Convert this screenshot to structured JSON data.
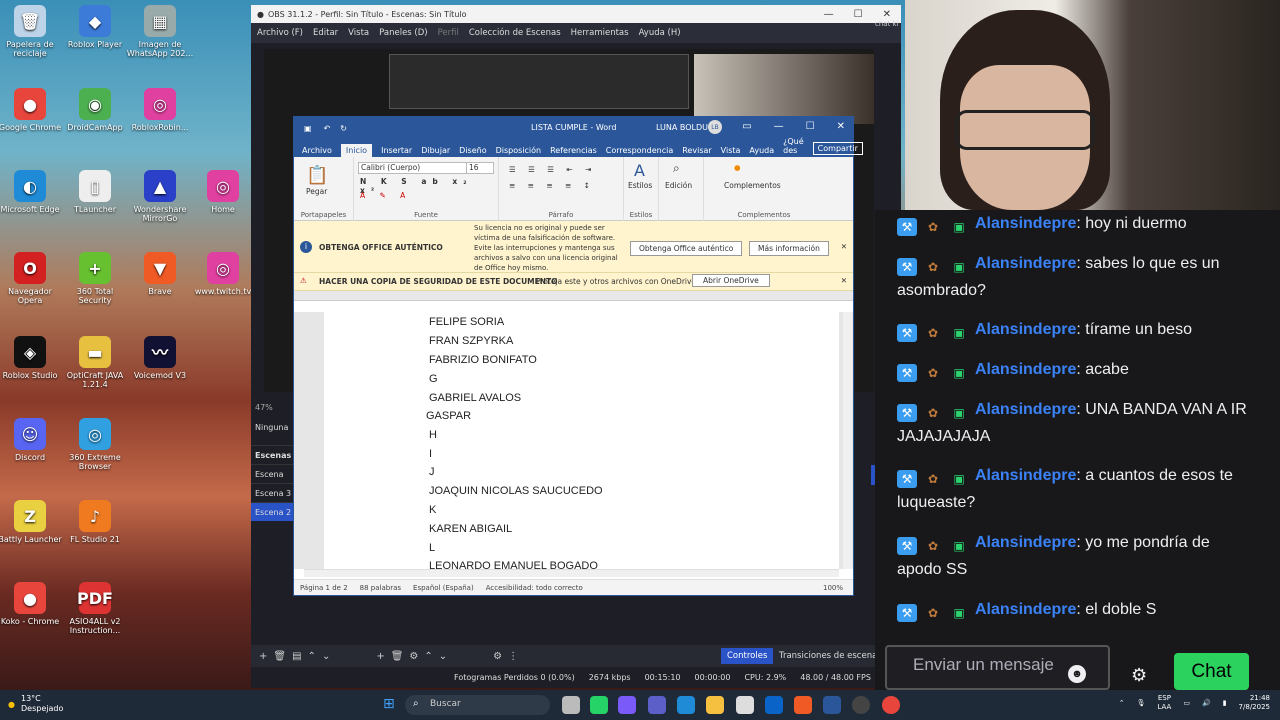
{
  "desktop": {
    "icons": [
      {
        "label": "Papelera de reciclaje",
        "glyph": "🗑",
        "color": "#bcd3e8"
      },
      {
        "label": "Roblox Player",
        "glyph": "◆",
        "color": "#3d7bd9"
      },
      {
        "label": "Imagen de WhatsApp 202...",
        "glyph": "▦",
        "color": "#9aa"
      },
      {
        "label": "Google Chrome",
        "glyph": "●",
        "color": "#e8453c"
      },
      {
        "label": "DroidCamApp",
        "glyph": "◉",
        "color": "#4caf50"
      },
      {
        "label": "RobloxRobin...",
        "glyph": "◎",
        "color": "#e040a0"
      },
      {
        "label": "Microsoft Edge",
        "glyph": "◐",
        "color": "#1f8bd6"
      },
      {
        "label": "TLauncher",
        "glyph": "▯",
        "color": "#eee"
      },
      {
        "label": "Wondershare MirrorGo",
        "glyph": "▲",
        "color": "#2a40c8"
      },
      {
        "label": "Home",
        "glyph": "◎",
        "color": "#e040a0"
      },
      {
        "label": "Navegador Opera",
        "glyph": "O",
        "color": "#d32020"
      },
      {
        "label": "360 Total Security",
        "glyph": "+",
        "color": "#66c030"
      },
      {
        "label": "Brave",
        "glyph": "▼",
        "color": "#f05a24"
      },
      {
        "label": "www.twitch.tv",
        "glyph": "◎",
        "color": "#e040a0"
      },
      {
        "label": "Roblox Studio",
        "glyph": "◈",
        "color": "#111"
      },
      {
        "label": "OptiCraft JAVA 1.21.4",
        "glyph": "▬",
        "color": "#e8c040"
      },
      {
        "label": "Voicemod V3",
        "glyph": "〰",
        "color": "#113"
      },
      {
        "label": "Discord",
        "glyph": "☺",
        "color": "#5865f2"
      },
      {
        "label": "360 Extreme Browser",
        "glyph": "◎",
        "color": "#30a0e0"
      },
      {
        "label": "Battly Launcher",
        "glyph": "Z",
        "color": "#e8d040"
      },
      {
        "label": "FL Studio 21",
        "glyph": "♪",
        "color": "#f07a20"
      },
      {
        "label": "Koko - Chrome",
        "glyph": "●",
        "color": "#e8453c"
      },
      {
        "label": "ASIO4ALL v2 Instruction...",
        "glyph": "PDF",
        "color": "#d33"
      }
    ]
  },
  "obs": {
    "title": "OBS 31.1.2 - Perfil: Sin Título - Escenas: Sin Título",
    "menu": [
      "Archivo (F)",
      "Editar",
      "Vista",
      "Paneles (D)",
      "Perfil",
      "Colección de Escenas",
      "Herramientas",
      "Ayuda (H)"
    ],
    "scenes_header": "Escenas",
    "scenes": [
      "Escena",
      "Escena 3",
      "Escena 2"
    ],
    "ninguna": "Ninguna",
    "zoom": "47%",
    "controls": "Controles",
    "transitions": "Transiciones de escena",
    "status": {
      "frames": "Fotogramas Perdidos 0 (0.0%)",
      "bitrate": "2674 kbps",
      "stream_time": "00:15:10",
      "rec_time": "00:00:00",
      "cpu": "CPU: 2.9%",
      "fps": "48.00 / 48.00 FPS"
    }
  },
  "word": {
    "doc_title": "LISTA CUMPLE - Word",
    "user": "LUNA BOLDU",
    "user_initials": "LB",
    "tabs": [
      "Archivo",
      "Inicio",
      "Insertar",
      "Dibujar",
      "Diseño",
      "Disposición",
      "Referencias",
      "Correspondencia",
      "Revisar",
      "Vista",
      "Ayuda",
      "¿Qué des"
    ],
    "share": "Compartir",
    "font": "Calibri (Cuerpo)",
    "font_size": "16",
    "ribbon": {
      "paste": "Pegar",
      "clipboard": "Portapapeles",
      "font": "Fuente",
      "paragraph": "Párrafo",
      "styles": "Estilos",
      "styles_cap": "Estilos",
      "edit": "Edición",
      "addins": "Complementos",
      "addins_cap": "Complementos"
    },
    "banner1": {
      "title": "OBTENGA OFFICE AUTÉNTICO",
      "msg": "Su licencia no es original y puede ser víctima de una falsificación de software. Evite las interrupciones y mantenga sus archivos a salvo con una licencia original de Office hoy mismo.",
      "btn1": "Obtenga Office auténtico",
      "btn2": "Más información"
    },
    "banner2": {
      "title": "HACER UNA COPIA DE SEGURIDAD DE ESTE DOCUMENTO",
      "msg": "Proteja este y otros archivos con OneDrive.",
      "btn": "Abrir OneDrive"
    },
    "lines": [
      "FELIPE SORIA",
      "FRAN SZPYRKA",
      "FABRIZIO BONIFATO",
      "G",
      "GABRIEL AVALOS",
      "GASPAR",
      "H",
      "I",
      "J",
      "JOAQUIN NICOLAS SAUCUCEDO",
      "K",
      "KAREN ABIGAIL",
      "L",
      "LEONARDO EMANUEL BOGADO"
    ],
    "status": {
      "page": "Página 1 de 2",
      "words": "88 palabras",
      "lang": "Español (España)",
      "access": "Accesibilidad: todo correcto",
      "zoom": "100%"
    }
  },
  "chat": {
    "top_label": "chat ki",
    "messages": [
      {
        "user": "Alansindepre",
        "text": ": hoy ni duermo"
      },
      {
        "user": "Alansindepre",
        "text": ": sabes lo que es un asombrado?"
      },
      {
        "user": "Alansindepre",
        "text": ": tírame un beso"
      },
      {
        "user": "Alansindepre",
        "text": ": acabe"
      },
      {
        "user": "Alansindepre",
        "text": ": UNA BANDA VAN A IR JAJAJAJAJA"
      },
      {
        "user": "Alansindepre",
        "text": ": a cuantos de esos te luqueaste?"
      },
      {
        "user": "Alansindepre",
        "text": ": yo me pondría de apodo SS"
      },
      {
        "user": "Alansindepre",
        "text": ": el doble S"
      }
    ],
    "placeholder": "Enviar un mensaje",
    "button": "Chat"
  },
  "taskbar": {
    "temp": "13°C",
    "weather": "Despejado",
    "search": "Buscar",
    "lang": "ESP",
    "lang2": "LAA",
    "time": "21:48",
    "date": "7/8/2025"
  }
}
